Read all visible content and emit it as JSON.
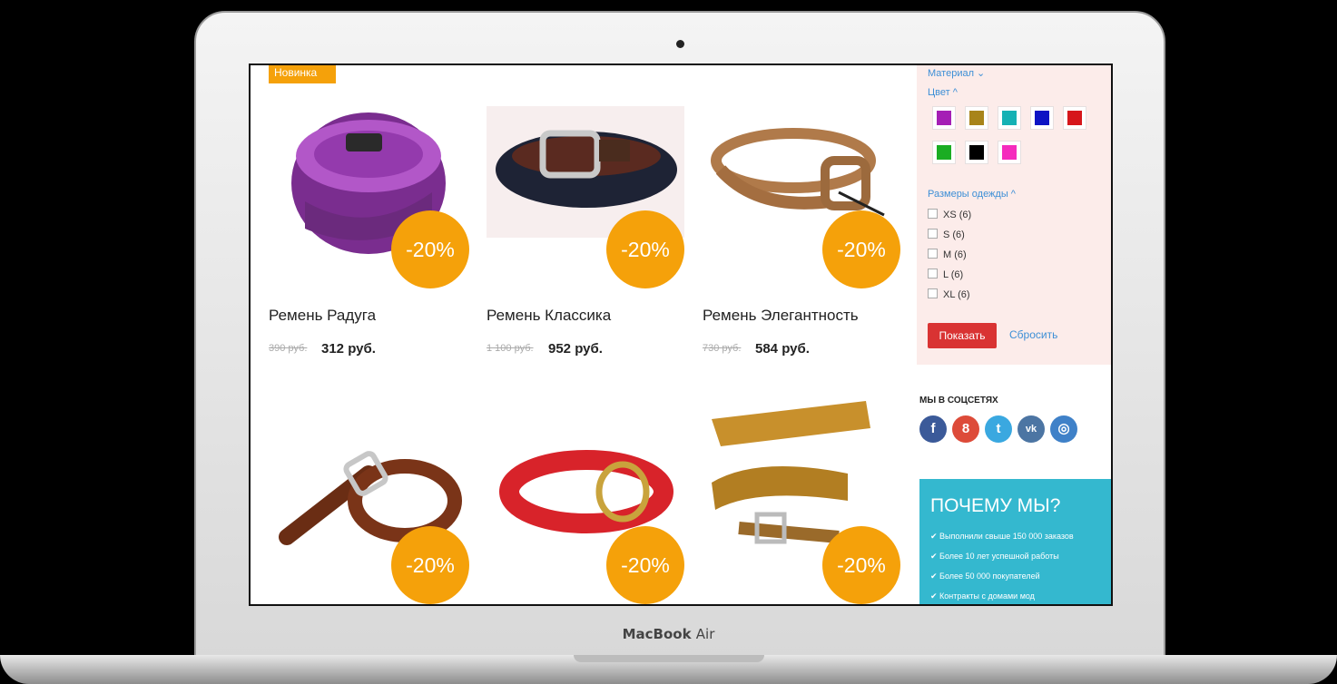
{
  "device": {
    "brand": "MacBook",
    "model": "Air"
  },
  "badge_new": "Новинка",
  "products": [
    {
      "name": "Ремень Радуга",
      "old_price": "390 руб.",
      "new_price": "312 руб.",
      "discount": "-20%"
    },
    {
      "name": "Ремень Классика",
      "old_price": "1 100 руб.",
      "new_price": "952 руб.",
      "discount": "-20%"
    },
    {
      "name": "Ремень Элегантность",
      "old_price": "730 руб.",
      "new_price": "584 руб.",
      "discount": "-20%"
    },
    {
      "discount": "-20%"
    },
    {
      "discount": "-20%"
    },
    {
      "discount": "-20%"
    }
  ],
  "filter": {
    "material": "Материал",
    "color": "Цвет",
    "swatches": [
      "#a51fb5",
      "#a8841a",
      "#15b1b4",
      "#0d13c4",
      "#d6161b",
      "#1aad23",
      "#000000",
      "#f52bbd"
    ],
    "sizes_title": "Размеры одежды",
    "sizes": [
      "XS (6)",
      "S (6)",
      "M (6)",
      "L (6)",
      "XL (6)"
    ],
    "show": "Показать",
    "reset": "Сбросить"
  },
  "social": {
    "title": "МЫ В СОЦСЕТЯХ",
    "icons": [
      {
        "name": "facebook-icon",
        "glyph": "f",
        "color": "#3b5a99"
      },
      {
        "name": "google-plus-icon",
        "glyph": "8",
        "color": "#dd4b39"
      },
      {
        "name": "twitter-icon",
        "glyph": "t",
        "color": "#3aa8e0"
      },
      {
        "name": "vk-icon",
        "glyph": "vk",
        "color": "#4c75a3"
      },
      {
        "name": "instagram-icon",
        "glyph": "◎",
        "color": "#3f81c8"
      }
    ]
  },
  "why": {
    "title": "ПОЧЕМУ МЫ?",
    "items": [
      "✔ Выполнили свыше 150 000 заказов",
      "✔ Более 10 лет успешной работы",
      "✔ Более 50 000 покупателей",
      "✔ Контракты с домами мод"
    ]
  }
}
